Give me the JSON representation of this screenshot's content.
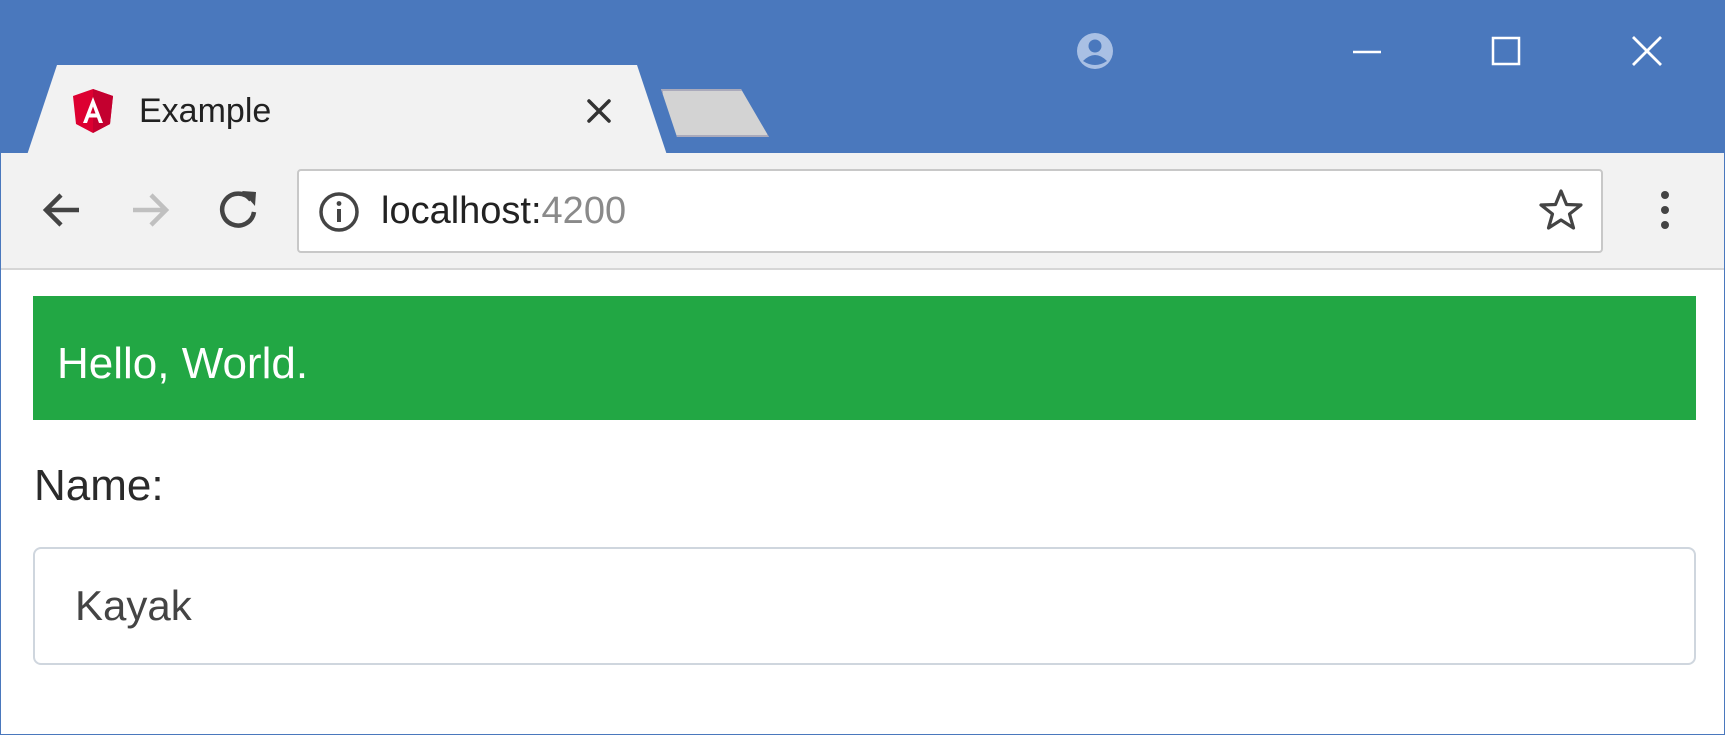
{
  "browser": {
    "tab": {
      "title": "Example",
      "favicon": "angular-logo-icon"
    },
    "address_bar": {
      "host": "localhost:",
      "port": "4200"
    },
    "icons": {
      "back": "arrow-left-icon",
      "forward": "arrow-right-icon",
      "reload": "reload-icon",
      "info": "info-icon",
      "bookmark": "star-icon",
      "menu": "more-vert-icon",
      "profile": "profile-icon"
    },
    "colors": {
      "titlebar": "#4a78bd",
      "toolbar": "#f2f2f2",
      "forward_disabled": "#c0c0c0"
    }
  },
  "page": {
    "alert": {
      "text": "Hello, World.",
      "color": "#22a744"
    },
    "form": {
      "name_label": "Name:",
      "name_value": "Kayak"
    }
  }
}
